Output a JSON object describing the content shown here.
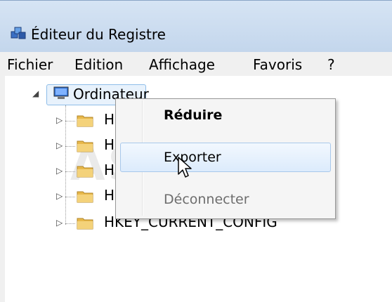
{
  "window": {
    "title": "Éditeur du Registre"
  },
  "menubar": {
    "items": [
      "Fichier",
      "Edition",
      "Affichage",
      "Favoris",
      "?"
    ]
  },
  "tree": {
    "root_label": "Ordinateur",
    "children": [
      {
        "label": "H"
      },
      {
        "label": "H"
      },
      {
        "label": "H"
      },
      {
        "label": "H"
      },
      {
        "label": "HKEY_CURRENT_CONFIG"
      }
    ]
  },
  "context_menu": {
    "items": [
      {
        "label": "Réduire",
        "style": "bold"
      },
      {
        "label": "Exporter",
        "style": "hover"
      },
      {
        "label": "Déconnecter",
        "style": "disabled"
      }
    ]
  },
  "watermark": {
    "text": "ASTUCES"
  },
  "colors": {
    "titlebar": "#cfdff2",
    "menubar": "#f0f0f0",
    "menu_hover": "#dcebfc",
    "folder": "#e8b84a"
  },
  "icons": [
    "registry-editor-icon",
    "computer-icon",
    "folder-icon",
    "expand-arrow-icon",
    "collapse-arrow-icon",
    "mouse-pointer-icon"
  ]
}
